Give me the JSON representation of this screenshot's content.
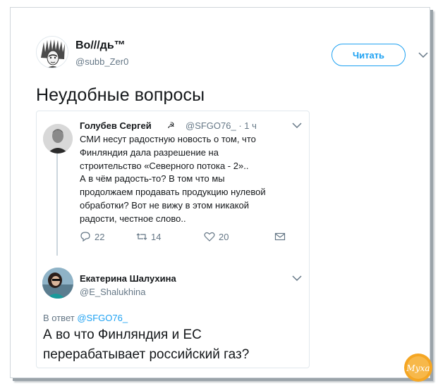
{
  "author": {
    "display_name": "Bo///дь™",
    "handle": "@subb_Zer0",
    "follow_label": "Читать"
  },
  "tweet": {
    "text": "Неудобные вопросы"
  },
  "quoted": {
    "name": "Голубев Сергей",
    "name_icon": "☭",
    "handle": "@SFGO76_",
    "time": "· 1 ч",
    "lines": [
      "СМИ несут радостную новость о том, что",
      "Финляндия дала разрешение на",
      "строительство «Северного потока - 2»..",
      "А в чём радость-то? В том что мы",
      "продолжаем продавать продукцию нулевой",
      "обработки?  Вот не вижу в этом никакой",
      "радости, честное слово.."
    ],
    "actions": {
      "replies": "22",
      "retweets": "14",
      "likes": "20"
    }
  },
  "reply": {
    "name": "Екатерина Шалухина",
    "handle": "@E_Shalukhina",
    "reply_prefix": "В ответ",
    "reply_to": "@SFGO76_",
    "text_line1": "А во что Финляндия и ЕС",
    "text_line2": "перерабатывает российский газ?"
  },
  "watermark": {
    "text": "Муха"
  },
  "colors": {
    "accent": "#1da1f2",
    "muted": "#657786",
    "border": "#e1e8ed",
    "logo": "#f5a623"
  }
}
